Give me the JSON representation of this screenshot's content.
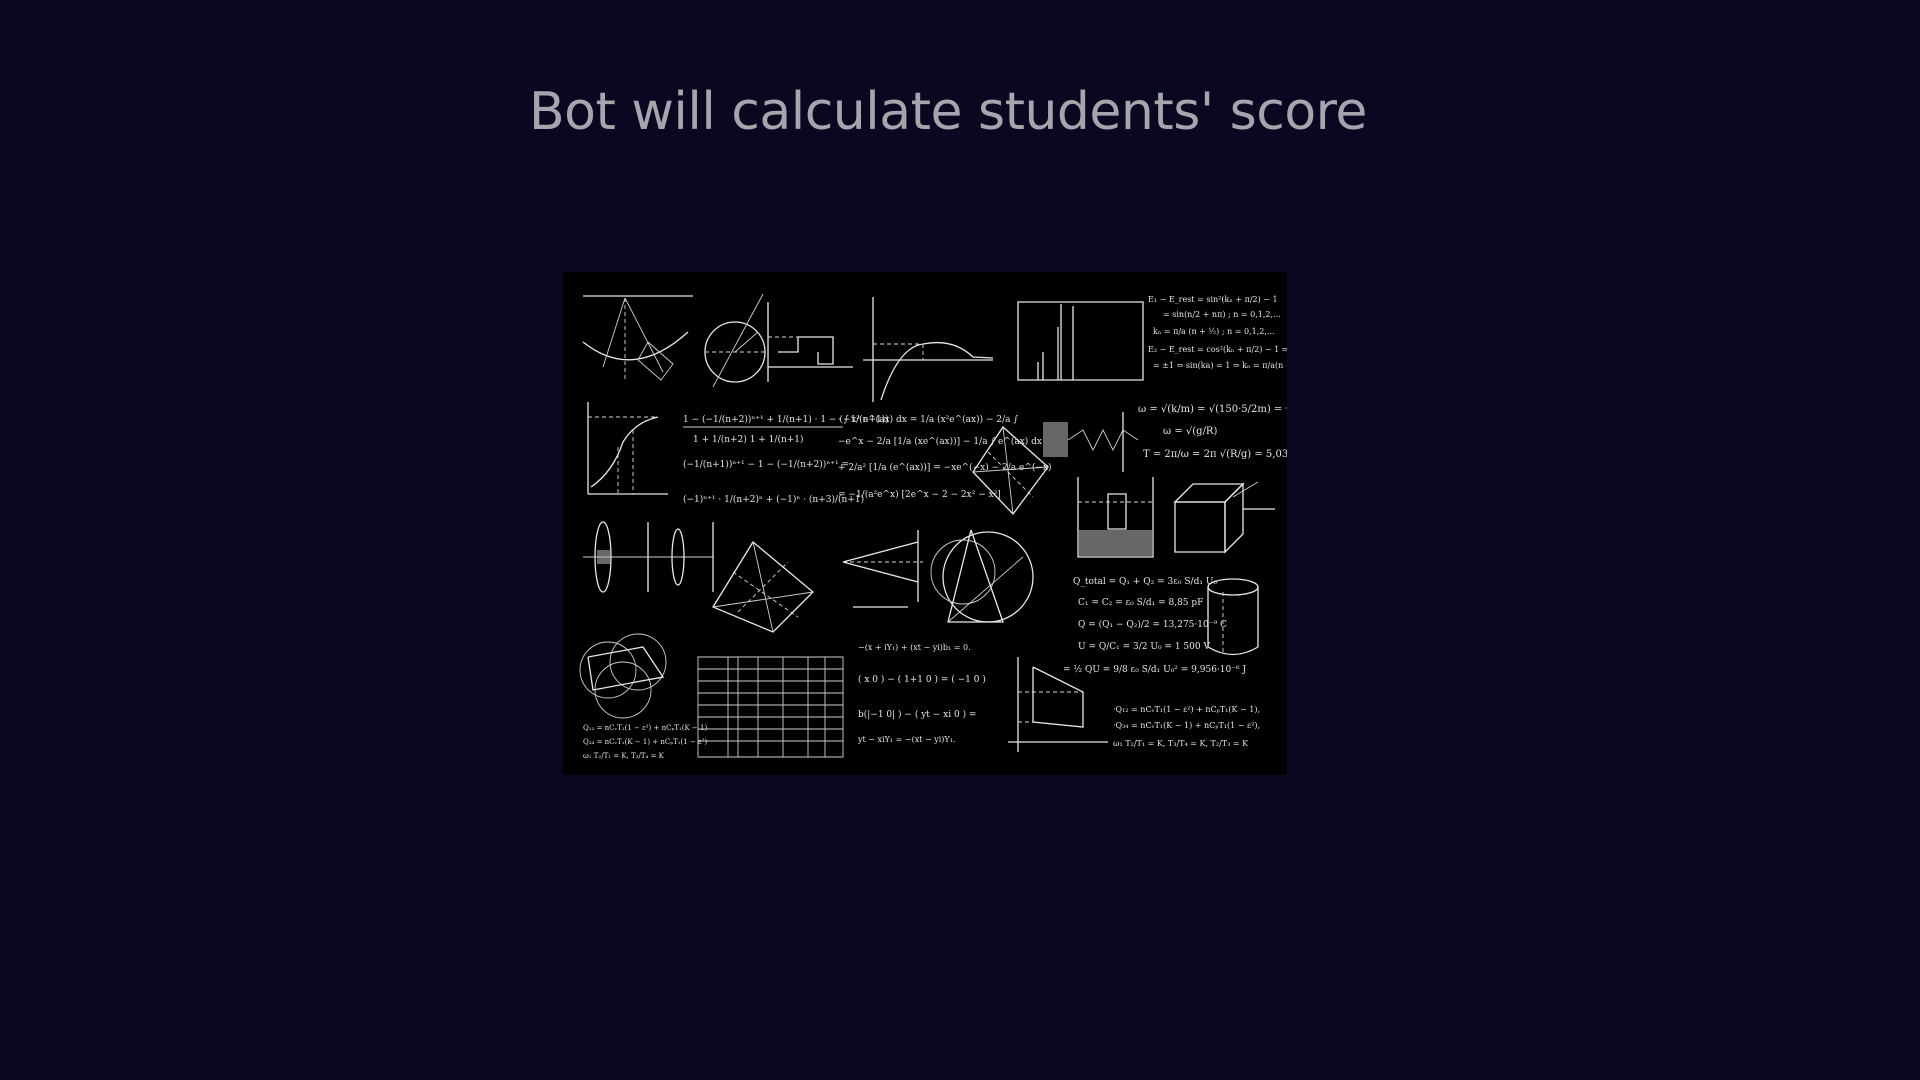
{
  "slide": {
    "title": "Bot will calculate students' score"
  },
  "illustration": {
    "description_icon": "physics-formula-blackboard",
    "background_color": "#000000",
    "page_background": "#0a0820",
    "title_color": "#a6a5ae"
  }
}
